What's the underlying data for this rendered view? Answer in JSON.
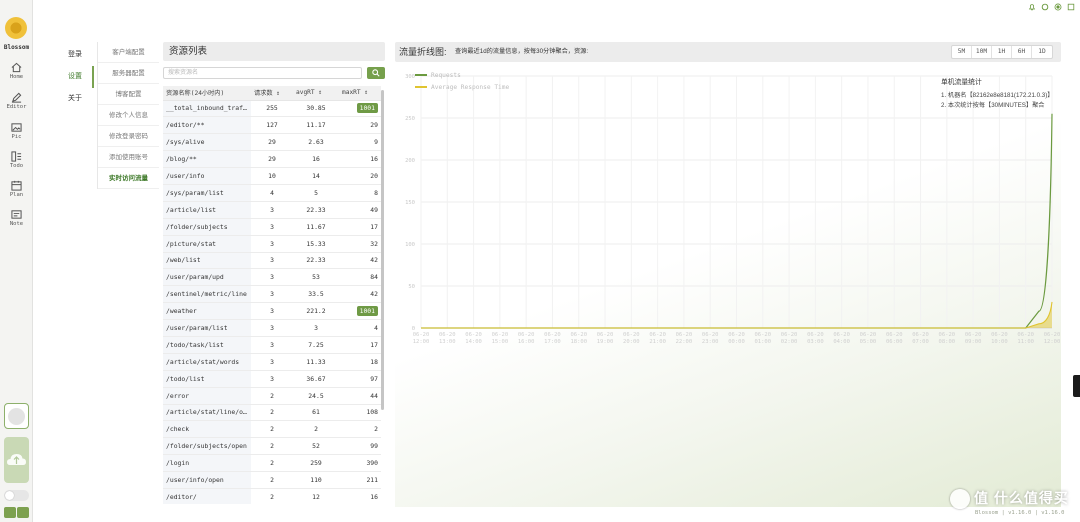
{
  "rail": {
    "logo_text": "Blossom",
    "items": [
      {
        "label": "Home",
        "icon": "home-icon"
      },
      {
        "label": "Editor",
        "icon": "editor-icon"
      },
      {
        "label": "Pic",
        "icon": "picture-icon"
      },
      {
        "label": "Todo",
        "icon": "todo-icon"
      },
      {
        "label": "Plan",
        "icon": "calendar-icon"
      },
      {
        "label": "Note",
        "icon": "note-icon"
      }
    ]
  },
  "nav1": [
    "登录",
    "设置",
    "关于"
  ],
  "nav2": [
    "客户端配置",
    "服务器配置",
    "博客配置",
    "修改个人信息",
    "修改登录密码",
    "添加使用账号",
    "实时访问流量"
  ],
  "resources": {
    "title": "资源列表",
    "search_placeholder": "搜索资源名",
    "headers": [
      "资源名称(24小时内)",
      "请求数",
      "avgRT",
      "maxRT"
    ],
    "rows": [
      [
        "__total_inbound_traffic__",
        "255",
        "30.85",
        "1001"
      ],
      [
        "/editor/**",
        "127",
        "11.17",
        "29"
      ],
      [
        "/sys/alive",
        "29",
        "2.63",
        "9"
      ],
      [
        "/blog/**",
        "29",
        "16",
        "16"
      ],
      [
        "/user/info",
        "10",
        "14",
        "20"
      ],
      [
        "/sys/param/list",
        "4",
        "5",
        "8"
      ],
      [
        "/article/list",
        "3",
        "22.33",
        "49"
      ],
      [
        "/folder/subjects",
        "3",
        "11.67",
        "17"
      ],
      [
        "/picture/stat",
        "3",
        "15.33",
        "32"
      ],
      [
        "/web/list",
        "3",
        "22.33",
        "42"
      ],
      [
        "/user/param/upd",
        "3",
        "53",
        "84"
      ],
      [
        "/sentinel/metric/line",
        "3",
        "33.5",
        "42"
      ],
      [
        "/weather",
        "3",
        "221.2",
        "1001"
      ],
      [
        "/user/param/list",
        "3",
        "3",
        "4"
      ],
      [
        "/todo/task/list",
        "3",
        "7.25",
        "17"
      ],
      [
        "/article/stat/words",
        "3",
        "11.33",
        "18"
      ],
      [
        "/todo/list",
        "3",
        "36.67",
        "97"
      ],
      [
        "/error",
        "2",
        "24.5",
        "44"
      ],
      [
        "/article/stat/line/o...",
        "2",
        "61",
        "108"
      ],
      [
        "/check",
        "2",
        "2",
        "2"
      ],
      [
        "/folder/subjects/open",
        "2",
        "52",
        "99"
      ],
      [
        "/login",
        "2",
        "259",
        "390"
      ],
      [
        "/user/info/open",
        "2",
        "110",
        "211"
      ],
      [
        "/editor/",
        "2",
        "12",
        "16"
      ]
    ]
  },
  "flow": {
    "title": "流量折线图:",
    "subtitle": "查询最近1d的流量信息，按每30分钟聚合，资源:",
    "ranges": [
      "5M",
      "10M",
      "1H",
      "6H",
      "1D"
    ],
    "stats_title": "单机流量统计",
    "stats_lines": [
      "1. 机器名【82162e8e8181(172.21.0.3)】",
      "2. 本次统计按每【30MINUTES】聚合"
    ]
  },
  "chart_data": {
    "type": "line",
    "series": [
      {
        "name": "Requests",
        "color": "#6b9a3f",
        "values": [
          0,
          0,
          0,
          0,
          0,
          0,
          0,
          0,
          0,
          0,
          0,
          0,
          0,
          0,
          0,
          0,
          0,
          0,
          0,
          0,
          0,
          0,
          0,
          0,
          0,
          0,
          0,
          0,
          0,
          0,
          0,
          0,
          0,
          0,
          0,
          0,
          0,
          0,
          0,
          0,
          0,
          0,
          0,
          0,
          0,
          0,
          0,
          20,
          255
        ]
      },
      {
        "name": "Average Response Time",
        "color": "#e0c430",
        "values": [
          0,
          0,
          0,
          0,
          0,
          0,
          0,
          0,
          0,
          0,
          0,
          0,
          0,
          0,
          0,
          0,
          0,
          0,
          0,
          0,
          0,
          0,
          0,
          0,
          0,
          0,
          0,
          0,
          0,
          0,
          0,
          0,
          0,
          0,
          0,
          0,
          0,
          0,
          0,
          0,
          0,
          0,
          0,
          0,
          0,
          0,
          0,
          5,
          31
        ]
      }
    ],
    "yticks": [
      "0",
      "50",
      "100",
      "150",
      "200",
      "250",
      "300"
    ],
    "ylim": [
      0,
      300
    ],
    "xticks": [
      "12:00",
      "13:00",
      "14:00",
      "15:00",
      "16:00",
      "17:00",
      "18:00",
      "19:00",
      "20:00",
      "21:00",
      "22:00",
      "23:00",
      "00:00",
      "01:00",
      "02:00",
      "03:00",
      "04:00",
      "05:00",
      "06:00",
      "07:00",
      "08:00",
      "09:00",
      "10:00",
      "11:00",
      "12:00"
    ],
    "x_date_prefix": "06-20"
  },
  "footer": {
    "version": "Blossom | v1.16.0 | v1.16.0",
    "watermark": "值 什么值得买"
  }
}
